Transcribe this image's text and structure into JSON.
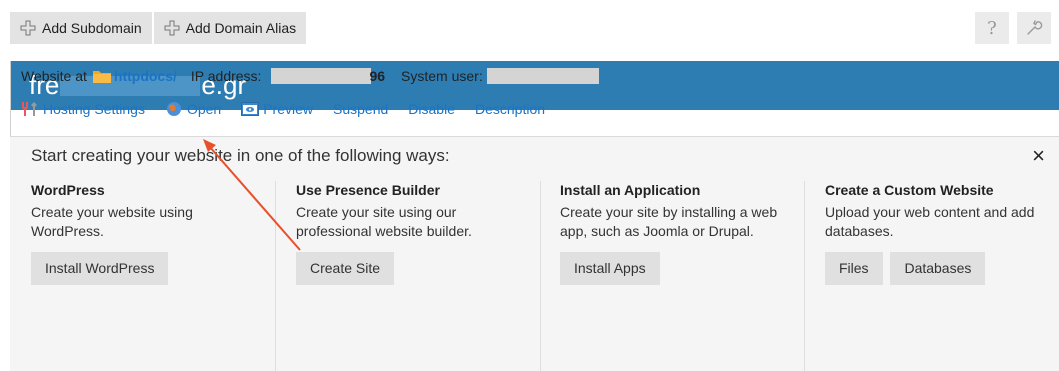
{
  "toolbar": {
    "add_subdomain": "Add Subdomain",
    "add_domain_alias": "Add Domain Alias",
    "help_glyph": "?"
  },
  "header": {
    "domain_prefix": "fre",
    "domain_suffix": "e.gr"
  },
  "info": {
    "website_at": "Website at",
    "docroot": "httpdocs/",
    "ip_label": "IP address:",
    "ip_suffix": "96",
    "system_user_label": "System user:"
  },
  "actions": {
    "hosting_settings": "Hosting Settings",
    "open": "Open",
    "preview": "Preview",
    "suspend": "Suspend",
    "disable": "Disable",
    "description": "Description"
  },
  "start": {
    "title": "Start creating your website in one of the following ways:",
    "close": "×",
    "columns": [
      {
        "title": "WordPress",
        "text": "Create your website using WordPress.",
        "buttons": [
          "Install WordPress"
        ]
      },
      {
        "title": "Use Presence Builder",
        "text": "Create your site using our professional website builder.",
        "buttons": [
          "Create Site"
        ]
      },
      {
        "title": "Install an Application",
        "text": "Create your site by installing a web app, such as Joomla or Drupal.",
        "buttons": [
          "Install Apps"
        ]
      },
      {
        "title": "Create a Custom Website",
        "text": "Upload your web content and add databases.",
        "buttons": [
          "Files",
          "Databases"
        ]
      }
    ]
  },
  "colors": {
    "header_bg": "#2d7db3",
    "link": "#1a73c6",
    "annotation_arrow": "#e8502a"
  }
}
